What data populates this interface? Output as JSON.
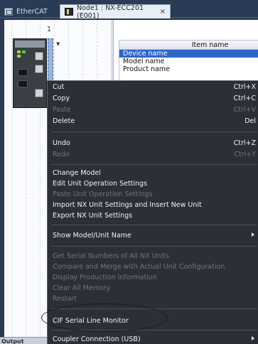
{
  "tabs": [
    {
      "label": "EtherCAT",
      "icon": "ethercat-icon"
    },
    {
      "label": "Node1 : NX-ECC201 (E001)",
      "icon": "node-icon",
      "close": "×"
    }
  ],
  "canvas": {
    "slot_number": "1"
  },
  "properties": {
    "header": "Item name",
    "rows": [
      "Device name",
      "Model name",
      "Product name"
    ],
    "selected_index": 0
  },
  "bottom": {
    "label": "Output"
  },
  "context_menu": {
    "items": {
      "cut": {
        "label": "Cut",
        "shortcut": "Ctrl+X"
      },
      "copy": {
        "label": "Copy",
        "shortcut": "Ctrl+C"
      },
      "paste": {
        "label": "Paste",
        "shortcut": "Ctrl+V"
      },
      "delete": {
        "label": "Delete",
        "shortcut": "Del"
      },
      "undo": {
        "label": "Undo",
        "shortcut": "Ctrl+Z"
      },
      "redo": {
        "label": "Redo",
        "shortcut": "Ctrl+Y"
      },
      "change_model": {
        "label": "Change Model"
      },
      "edit_unit_op": {
        "label": "Edit Unit Operation Settings"
      },
      "paste_unit_op": {
        "label": "Paste Unit Operation Settings"
      },
      "import_nx": {
        "label": "Import NX Unit Settings and Insert New Unit"
      },
      "export_nx": {
        "label": "Export NX Unit Settings"
      },
      "show_model": {
        "label": "Show Model/Unit Name"
      },
      "get_serial": {
        "label": "Get Serial Numbers of All NX Units"
      },
      "compare_merge": {
        "label": "Compare and Merge with Actual Unit Configuration"
      },
      "display_production": {
        "label": "Display Production Information"
      },
      "clear_memory": {
        "label": "Clear All Memory"
      },
      "restart": {
        "label": "Restart"
      },
      "cif_monitor": {
        "label": "CIF Serial Line Monitor"
      },
      "coupler_connection": {
        "label": "Coupler Connection (USB)"
      }
    }
  }
}
